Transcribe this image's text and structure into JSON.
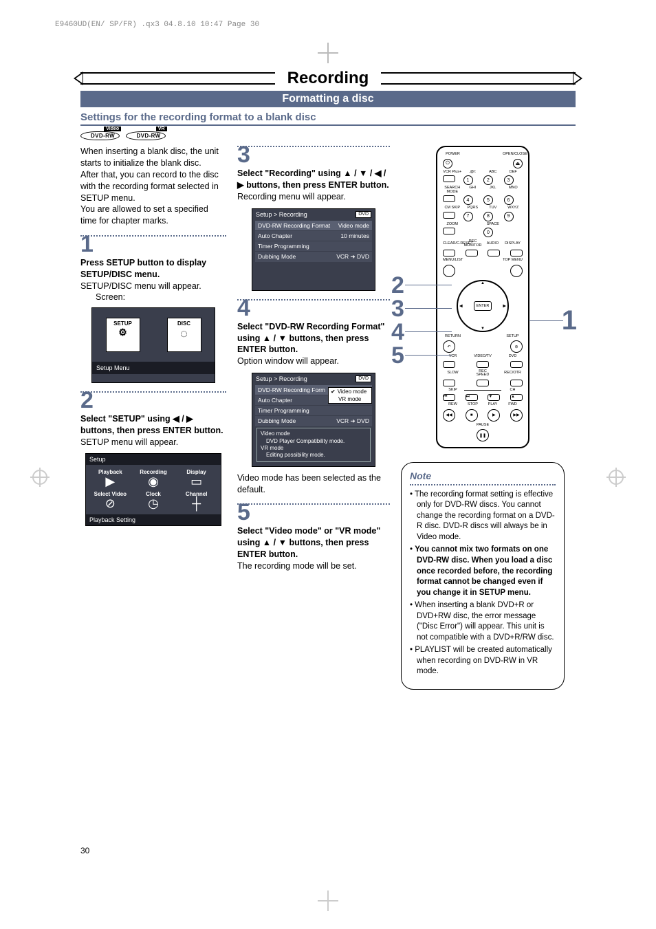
{
  "print_header": "E9460UD(EN/ SP/FR) .qx3  04.8.10  10:47  Page 30",
  "title": "Recording",
  "section_bar": "Formatting a disc",
  "settings_title": "Settings for the recording format to a blank disc",
  "badges": {
    "video": "DVD-RW",
    "video_tag": "Video",
    "vr": "DVD-RW",
    "vr_tag": "VR"
  },
  "intro": {
    "p1": "When inserting a blank disc, the unit starts to initialize the blank disc.",
    "p2": "After that, you can record to the disc with the recording format selected in SETUP menu.",
    "p3": "You are allowed to set a specified time for chapter marks."
  },
  "steps": {
    "s1": {
      "num": "1",
      "bold": "Press SETUP button to display SETUP/DISC menu.",
      "text": "SETUP/DISC menu will appear.",
      "screen_label": "Screen:",
      "osd": {
        "setup": "SETUP",
        "disc": "DISC",
        "footer": "Setup Menu"
      }
    },
    "s2": {
      "num": "2",
      "bold": "Select \"SETUP\" using ◀ / ▶ buttons, then press ENTER button.",
      "text": "SETUP menu will appear.",
      "osd": {
        "hdr": "Setup",
        "cells": [
          "Playback",
          "Recording",
          "Display",
          "Select Video",
          "Clock",
          "Channel"
        ],
        "ftr": "Playback Setting"
      }
    },
    "s3": {
      "num": "3",
      "bold": "Select \"Recording\" using ▲ / ▼ / ◀ / ▶ buttons, then press ENTER button.",
      "text": "Recording menu will appear.",
      "osd": {
        "crumb": "Setup > Recording",
        "chip": "DVD",
        "rows": [
          [
            "DVD-RW Recording Format",
            "Video mode"
          ],
          [
            "Auto Chapter",
            "10 minutes"
          ],
          [
            "Timer Programming",
            ""
          ],
          [
            "Dubbing Mode",
            "VCR ➔ DVD"
          ]
        ]
      }
    },
    "s4": {
      "num": "4",
      "bold": "Select \"DVD-RW Recording Format\" using ▲ / ▼ buttons, then press ENTER button.",
      "text": "Option window will appear.",
      "osd": {
        "crumb": "Setup > Recording",
        "chip": "DVD",
        "rows": [
          [
            "DVD-RW Recording Form",
            ""
          ],
          [
            "Auto Chapter",
            ""
          ],
          [
            "Timer Programming",
            ""
          ],
          [
            "Dubbing Mode",
            "VCR ➔ DVD"
          ]
        ],
        "popup": [
          "Video mode",
          "VR mode"
        ],
        "check": "✔",
        "info_l1": "Video mode",
        "info_l2": "DVD Player Compatibility mode.",
        "info_l3": "VR mode",
        "info_l4": "Editing possibility mode."
      },
      "below": "Video mode has been selected as the default."
    },
    "s5": {
      "num": "5",
      "bold": "Select \"Video mode\" or \"VR mode\" using ▲ / ▼ buttons, then press ENTER button.",
      "text": "The recording mode will be set."
    }
  },
  "remote": {
    "top": {
      "power": "POWER",
      "open": "OPEN/CLOSE"
    },
    "numlabels": {
      "r1": [
        "VCR Plus+",
        ".@/:",
        "ABC",
        "DEF"
      ],
      "r2": [
        "SEARCH MODE",
        "GHI",
        "JKL",
        "MNO"
      ],
      "r3": [
        "CM SKIP",
        "PQRS",
        "TUV",
        "WXYZ"
      ],
      "r4": [
        "ZOOM",
        "",
        "SPACE",
        ""
      ]
    },
    "nums": [
      "1",
      "2",
      "3",
      "4",
      "5",
      "6",
      "7",
      "8",
      "9",
      "0"
    ],
    "midlabels": [
      "CLEAR/C.RESET",
      "REC MONITOR",
      "AUDIO",
      "DISPLAY"
    ],
    "menulist": "MENU/LIST",
    "topmenu": "TOP MENU",
    "enter": "ENTER",
    "return": "RETURN",
    "setup": "SETUP",
    "row_vcr": [
      "VCR",
      "VIDEO/TV",
      "DVD"
    ],
    "row_rec": [
      "SLOW",
      "REC SPEED",
      "REC/OTR"
    ],
    "row_skip": [
      "SKIP",
      "",
      "CH"
    ],
    "row_play": [
      "REW",
      "STOP",
      "PLAY",
      "FWD"
    ],
    "pause": "PAUSE",
    "callouts": {
      "left": [
        "2",
        "3",
        "4",
        "5"
      ],
      "right": "1"
    }
  },
  "note": {
    "title": "Note",
    "items": [
      "The recording format setting is effective only for DVD-RW discs. You cannot change the recording format on a DVD-R disc. DVD-R discs will always be in Video mode.",
      "BOLD::You cannot mix two formats on one DVD-RW disc. When you load a disc once recorded before, the recording format cannot be changed even if you change it in SETUP menu.",
      "When inserting a blank DVD+R or DVD+RW disc, the error message (\"Disc Error\") will appear. This unit is not compatible with a DVD+R/RW disc.",
      "PLAYLIST will be created automatically when recording on DVD-RW in VR mode."
    ]
  },
  "pagenum": "30"
}
